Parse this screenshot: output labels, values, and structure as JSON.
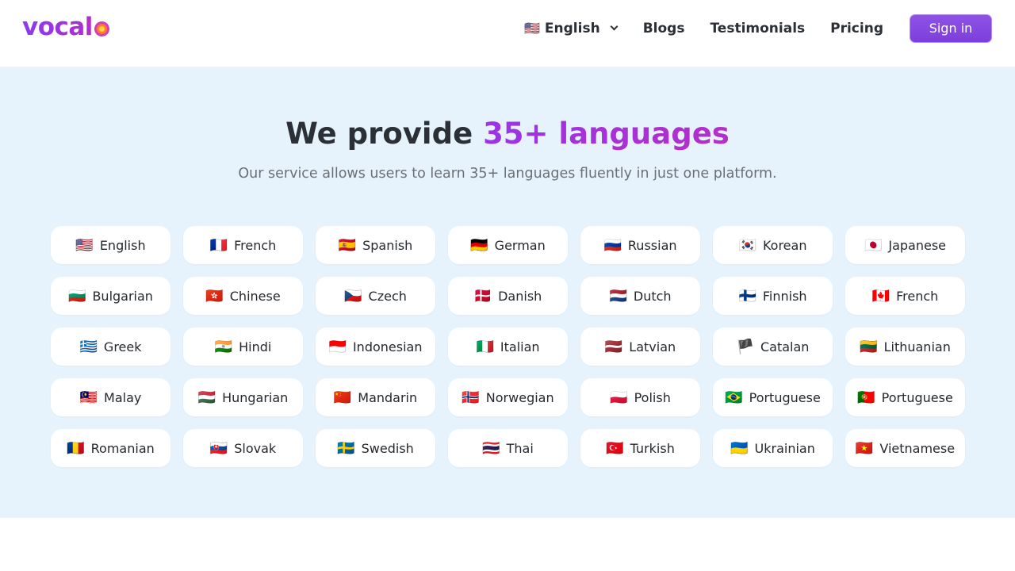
{
  "header": {
    "logo_text": "vocal",
    "language_selector": {
      "flag": "🇺🇸",
      "label": "English"
    },
    "nav": [
      "Blogs",
      "Testimonials",
      "Pricing"
    ],
    "signin_label": "Sign in"
  },
  "hero": {
    "title_prefix": "We provide ",
    "title_accent": "35+ languages",
    "subtitle": "Our service allows users to learn 35+ languages fluently in just one platform."
  },
  "languages": [
    {
      "flag": "🇺🇸",
      "name": "English"
    },
    {
      "flag": "🇫🇷",
      "name": "French"
    },
    {
      "flag": "🇪🇸",
      "name": "Spanish"
    },
    {
      "flag": "🇩🇪",
      "name": "German"
    },
    {
      "flag": "🇷🇺",
      "name": "Russian"
    },
    {
      "flag": "🇰🇷",
      "name": "Korean"
    },
    {
      "flag": "🇯🇵",
      "name": "Japanese"
    },
    {
      "flag": "🇧🇬",
      "name": "Bulgarian"
    },
    {
      "flag": "🇭🇰",
      "name": "Chinese"
    },
    {
      "flag": "🇨🇿",
      "name": "Czech"
    },
    {
      "flag": "🇩🇰",
      "name": "Danish"
    },
    {
      "flag": "🇳🇱",
      "name": "Dutch"
    },
    {
      "flag": "🇫🇮",
      "name": "Finnish"
    },
    {
      "flag": "🇨🇦",
      "name": "French"
    },
    {
      "flag": "🇬🇷",
      "name": "Greek"
    },
    {
      "flag": "🇮🇳",
      "name": "Hindi"
    },
    {
      "flag": "🇮🇩",
      "name": "Indonesian"
    },
    {
      "flag": "🇮🇹",
      "name": "Italian"
    },
    {
      "flag": "🇱🇻",
      "name": "Latvian"
    },
    {
      "flag": "🏴",
      "name": "Catalan"
    },
    {
      "flag": "🇱🇹",
      "name": "Lithuanian"
    },
    {
      "flag": "🇲🇾",
      "name": "Malay"
    },
    {
      "flag": "🇭🇺",
      "name": "Hungarian"
    },
    {
      "flag": "🇨🇳",
      "name": "Mandarin"
    },
    {
      "flag": "🇳🇴",
      "name": "Norwegian"
    },
    {
      "flag": "🇵🇱",
      "name": "Polish"
    },
    {
      "flag": "🇧🇷",
      "name": "Portuguese"
    },
    {
      "flag": "🇵🇹",
      "name": "Portuguese"
    },
    {
      "flag": "🇷🇴",
      "name": "Romanian"
    },
    {
      "flag": "🇸🇰",
      "name": "Slovak"
    },
    {
      "flag": "🇸🇪",
      "name": "Swedish"
    },
    {
      "flag": "🇹🇭",
      "name": "Thai"
    },
    {
      "flag": "🇹🇷",
      "name": "Turkish"
    },
    {
      "flag": "🇺🇦",
      "name": "Ukrainian"
    },
    {
      "flag": "🇻🇳",
      "name": "Vietnamese"
    }
  ]
}
